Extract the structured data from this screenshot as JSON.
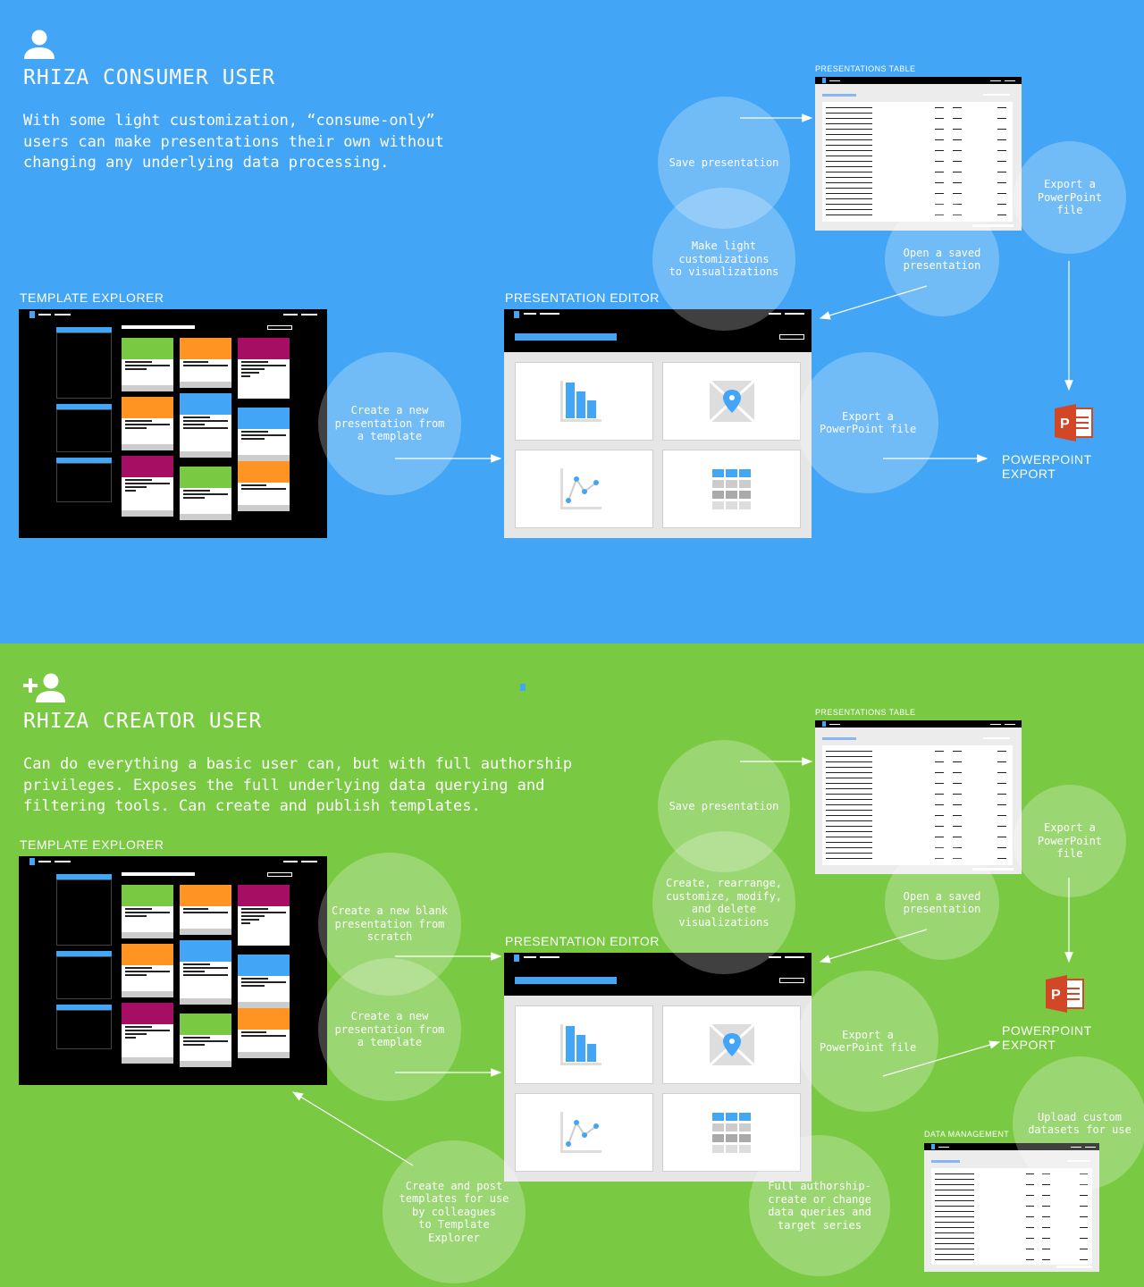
{
  "colors": {
    "consumer_bg": "#42a5f5",
    "creator_bg": "#79c942",
    "accent": "#42a5f5",
    "ppt": "#d24726"
  },
  "icons": {
    "consumer": "person-icon",
    "creator": "person-add-icon",
    "powerpoint": "powerpoint-icon"
  },
  "consumer": {
    "title": "RHIZA CONSUMER USER",
    "description": "With some light customization, “consume-only”\nusers can make presentations their own without\nchanging any underlying data processing.",
    "labels": {
      "template_explorer": "TEMPLATE EXPLORER",
      "presentation_editor": "PRESENTATION EDITOR",
      "presentations_table": "PRESENTATIONS TABLE",
      "powerpoint_export": "POWERPOINT EXPORT"
    },
    "bubbles": {
      "create_from_template": "Create a new\npresentation from\na template",
      "save": "Save presentation",
      "customize": "Make light\ncustomizations\nto visualizations",
      "open_saved": "Open a saved\npresentation",
      "export_top": "Export a\nPowerPoint\nfile",
      "export_mid": "Export a\nPowerPoint file"
    }
  },
  "creator": {
    "title": "RHIZA CREATOR USER",
    "description": "Can do everything a basic user can, but with full authorship\nprivileges. Exposes the full underlying data querying and\nfiltering tools. Can create and publish templates.",
    "labels": {
      "template_explorer": "TEMPLATE EXPLORER",
      "presentation_editor": "PRESENTATION EDITOR",
      "presentations_table": "PRESENTATIONS TABLE",
      "powerpoint_export": "POWERPOINT EXPORT",
      "data_management": "DATA MANAGEMENT"
    },
    "bubbles": {
      "create_blank": "Create a new blank\npresentation from\nscratch",
      "create_from_template": "Create a new\npresentation from\na template",
      "save": "Save presentation",
      "create_viz": "Create, rearrange,\ncustomize, modify,\nand delete\nvisualizations",
      "open_saved": "Open a saved\npresentation",
      "export_top": "Export a\nPowerPoint\nfile",
      "export_mid": "Export a\nPowerPoint file",
      "upload": "Upload custom\ndatasets for use",
      "post_templates": "Create and post\ntemplates for use\nby colleagues\nto Template\nExplorer",
      "full_authorship": "Full authorship-\ncreate or change\ndata queries and\ntarget series"
    }
  }
}
